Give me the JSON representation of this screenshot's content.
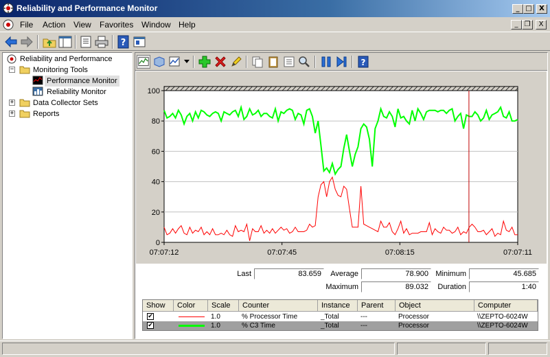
{
  "window": {
    "title": "Reliability and Performance Monitor",
    "controls": {
      "minimize": "_",
      "maximize": "□",
      "close": "X"
    }
  },
  "menu": {
    "items": [
      "File",
      "Action",
      "View",
      "Favorites",
      "Window",
      "Help"
    ],
    "mdi_controls": {
      "minimize": "_",
      "restore": "❐",
      "close": "X"
    }
  },
  "tree": {
    "root": "Reliability and Performance",
    "items": [
      {
        "label": "Monitoring Tools",
        "expander": "−"
      },
      {
        "label": "Performance Monitor",
        "selected": true
      },
      {
        "label": "Reliability Monitor"
      },
      {
        "label": "Data Collector Sets",
        "expander": "+"
      },
      {
        "label": "Reports",
        "expander": "+"
      }
    ]
  },
  "chart_data": {
    "type": "line",
    "yticks": [
      0,
      20,
      40,
      60,
      80,
      100
    ],
    "ylim": [
      0,
      100
    ],
    "xticks": [
      "07:07:12",
      "07:07:45",
      "07:08:15",
      "07:07:11"
    ],
    "cursor_fraction": 0.862,
    "series": [
      {
        "name": "% Processor Time",
        "color": "#ff0000",
        "values": [
          10,
          5,
          6,
          9,
          6,
          9,
          11,
          6,
          5,
          10,
          6,
          8,
          7,
          10,
          5,
          7,
          5,
          9,
          5,
          5,
          6,
          5,
          8,
          5,
          4,
          11,
          7,
          8,
          7,
          12,
          1,
          9,
          7,
          7,
          11,
          6,
          8,
          6,
          9,
          6,
          8,
          10,
          8,
          9,
          6,
          7,
          10,
          7,
          7,
          7,
          8,
          12,
          10,
          11,
          30,
          38,
          40,
          30,
          40,
          43,
          35,
          31,
          30,
          37,
          35,
          22,
          10,
          10,
          10,
          37,
          12,
          11,
          10,
          9,
          8,
          7,
          14,
          10,
          10,
          13,
          7,
          5,
          9,
          14,
          6,
          9,
          5,
          6,
          6,
          6,
          7,
          7,
          7,
          13,
          5,
          9,
          7,
          6,
          10,
          8,
          8,
          6,
          7,
          10,
          5,
          7,
          6,
          10,
          12,
          10,
          7,
          7,
          8,
          5,
          7,
          9,
          4,
          6,
          5,
          14,
          8,
          7,
          10,
          5,
          5
        ]
      },
      {
        "name": "% C3 Time",
        "color": "#00ff00",
        "values": [
          87,
          82,
          83,
          85,
          82,
          87,
          84,
          78,
          83,
          85,
          80,
          86,
          82,
          87,
          86,
          84,
          83,
          85,
          86,
          85,
          80,
          86,
          85,
          84,
          86,
          87,
          83,
          89,
          81,
          83,
          88,
          84,
          85,
          87,
          83,
          85,
          85,
          83,
          82,
          88,
          80,
          86,
          85,
          87,
          88,
          87,
          81,
          85,
          84,
          78,
          87,
          88,
          83,
          72,
          80,
          64,
          47,
          49,
          46,
          52,
          45,
          48,
          50,
          62,
          71,
          60,
          50,
          58,
          63,
          75,
          78,
          76,
          68,
          50,
          75,
          80,
          88,
          83,
          82,
          86,
          83,
          76,
          88,
          82,
          83,
          80,
          78,
          87,
          80,
          88,
          85,
          81,
          86,
          87,
          87,
          87,
          86,
          87,
          87,
          85,
          87,
          88,
          80,
          83,
          85,
          75,
          84,
          83,
          83,
          86,
          84,
          80,
          82,
          87,
          81,
          84,
          85,
          86,
          89,
          83,
          82,
          86,
          80,
          80,
          81
        ]
      }
    ]
  },
  "stats": {
    "last_label": "Last",
    "last": "83.659",
    "average_label": "Average",
    "average": "78.900",
    "minimum_label": "Minimum",
    "minimum": "45.685",
    "maximum_label": "Maximum",
    "maximum": "89.032",
    "duration_label": "Duration",
    "duration": "1:40"
  },
  "table": {
    "headers": [
      "Show",
      "Color",
      "Scale",
      "Counter",
      "Instance",
      "Parent",
      "Object",
      "Computer"
    ],
    "rows": [
      {
        "show": "✔",
        "color": "#ff0000",
        "scale": "1.0",
        "counter": "% Processor Time",
        "instance": "_Total",
        "parent": "---",
        "object": "Processor",
        "computer": "\\\\ZEPTO-6024W"
      },
      {
        "show": "✔",
        "color": "#00ff00",
        "scale": "1.0",
        "counter": "% C3 Time",
        "instance": "_Total",
        "parent": "---",
        "object": "Processor",
        "computer": "\\\\ZEPTO-6024W"
      }
    ]
  }
}
